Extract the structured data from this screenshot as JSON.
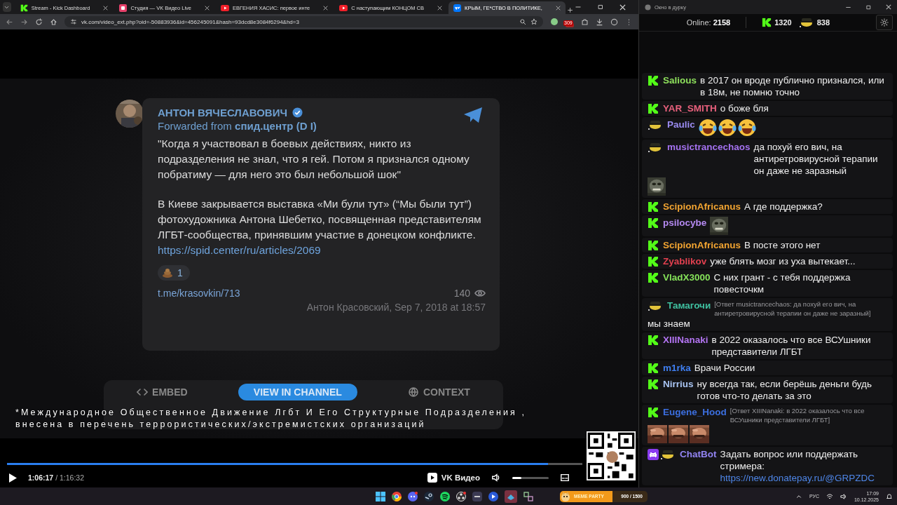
{
  "browser": {
    "tabs": [
      {
        "title": "Stream - Kick Dashboard",
        "kind": "kick",
        "selected": false
      },
      {
        "title": "Студия — VK Видео Live",
        "kind": "studio",
        "selected": false
      },
      {
        "title": "ЕВГЕНИЯ ХАСИС: первое инте",
        "kind": "video",
        "selected": false
      },
      {
        "title": "С наступающим КОНЦОМ СВ",
        "kind": "video",
        "selected": false
      },
      {
        "title": "КРЫМ, ГЕ*СТВО В ПОЛИТИКЕ,",
        "kind": "vk",
        "selected": true
      }
    ],
    "url": "vk.com/video_ext.php?oid=-50883936&id=456245091&hash=93dcd8e3084f6294&hd=3",
    "extension_badge": "309"
  },
  "video": {
    "post": {
      "author": "АНТОН ВЯЧЕСЛАВОВИЧ",
      "verified": true,
      "forwarded": "Forwarded from **спид.центр (D I)**",
      "paragraphs": [
        "\"Когда я участвовал в боевых действиях, никто из подразделения не знал, что я гей. Потом я признался одному побратиму — для него это был небольшой шок\"",
        "В Киеве закрывается выставка «Ми були тут» (“Мы были тут”) фотохудожника Антона Шебетко, посвященная представителям ЛГБТ-сообщества, принявшим участие в донецком конфликте."
      ],
      "link": "https://spid.center/ru/articles/2069",
      "reaction_count": "1",
      "post_link": "t.me/krasovkin/713",
      "views": "140",
      "signature": "Антон Красовский, Sep 7, 2018 at 18:57",
      "buttons": [
        {
          "label": "EMBED",
          "kind": "embed"
        },
        {
          "label": "VIEW IN CHANNEL",
          "kind": "primary"
        },
        {
          "label": "CONTEXT",
          "kind": "context"
        }
      ]
    },
    "notice": [
      "*Международное Общественное Движение Лгбт И Его Структурные Подразделения ,",
      "внесена в перечень террористических/экстремистских организаций"
    ],
    "progress": {
      "level": 0.94
    },
    "time_current": "1:06:17",
    "time_total": "/ 1:16:32",
    "brand": "VK Видео",
    "volume": {
      "level": 0.25
    }
  },
  "chat": {
    "window_title": "Окно в дурку",
    "online_label": "Online:",
    "online": "2158",
    "kick_count": "1320",
    "hat_count": "838",
    "messages": [
      {
        "badges": [
          {
            "kind": "kick"
          }
        ],
        "user": "Salious",
        "color": "#8ee05c",
        "text": "в 2017 он вроде публично признался, или в 18м, не помню точно"
      },
      {
        "badges": [
          {
            "kind": "kick"
          }
        ],
        "user": "YAR_SMITH",
        "color": "#e8607c",
        "text": "о боже бля"
      },
      {
        "badges": [
          {
            "kind": "hat"
          }
        ],
        "user": "Paulic",
        "color": "#9b8cf2",
        "emotes": [
          {
            "kind": "laughing"
          },
          {
            "kind": "laughing"
          },
          {
            "kind": "laughing"
          }
        ]
      },
      {
        "badges": [
          {
            "kind": "hat"
          }
        ],
        "user": "musictrancechaos",
        "color": "#a472f0",
        "text": "да похуй его вич, на антиретровирусной терапии он даже не заразный",
        "emotes": [
          {
            "kind": "picture"
          }
        ]
      },
      {
        "badges": [
          {
            "kind": "kick"
          }
        ],
        "user": "ScipionAfricanus",
        "color": "#f2a431",
        "text": "А где поддержка?"
      },
      {
        "badges": [
          {
            "kind": "kick"
          }
        ],
        "user": "psilocybe",
        "color": "#b58af2",
        "emotes": [
          {
            "kind": "picture"
          }
        ]
      },
      {
        "badges": [
          {
            "kind": "kick"
          }
        ],
        "user": "ScipionAfricanus",
        "color": "#f2a431",
        "text": "В посте этого нет"
      },
      {
        "badges": [
          {
            "kind": "kick"
          }
        ],
        "user": "Zyablikov",
        "color": "#e2404f",
        "text": "уже блять мозг из уха вытекает..."
      },
      {
        "badges": [
          {
            "kind": "kick"
          }
        ],
        "user": "VladX3000",
        "color": "#86e35a",
        "text": "С них грант - с тебя поддержка повесточкм"
      },
      {
        "badges": [
          {
            "kind": "hat"
          }
        ],
        "user": "Тамагочи",
        "color": "#3fc0a0",
        "reply": "[Ответ musictrancechaos: да похуй его вич, на антиретровирусной терапии он даже не заразный]",
        "text": "мы знаем"
      },
      {
        "badges": [
          {
            "kind": "kick"
          }
        ],
        "user": "XIIINanaki",
        "color": "#b374f2",
        "text": "в 2022 оказалось что все ВСУшники представители ЛГБТ"
      },
      {
        "badges": [
          {
            "kind": "kick"
          }
        ],
        "user": "m1rka",
        "color": "#3f7ef0",
        "text": "Врачи России"
      },
      {
        "badges": [
          {
            "kind": "kick"
          }
        ],
        "user": "Nirrius",
        "color": "#a9c4f2",
        "text": "ну всегда так, если берёшь деньги будь готов что-то делать за это"
      },
      {
        "badges": [
          {
            "kind": "kick"
          }
        ],
        "user": "Eugene_Hood",
        "color": "#3c6fe0",
        "reply": "[Ответ XIIINanaki: в 2022 оказалось что все ВСУшники представители ЛГБТ]",
        "emotes": [
          {
            "kind": "picture"
          },
          {
            "kind": "picture"
          },
          {
            "kind": "picture"
          }
        ]
      },
      {
        "badges": [
          {
            "kind": "invader"
          },
          {
            "kind": "hat"
          }
        ],
        "user": "ChatBot",
        "color": "#9284f2",
        "text": "Задать вопрос или поддержать стримера:",
        "link": "https://new.donatepay.ru/@GRPZDC"
      }
    ]
  },
  "taskbar": {
    "widget": {
      "label": "MEME PARTY",
      "value": "900 / 1500",
      "level": 0.6
    },
    "language": "РУС",
    "time": "17:09",
    "date": "10.12.2025"
  }
}
